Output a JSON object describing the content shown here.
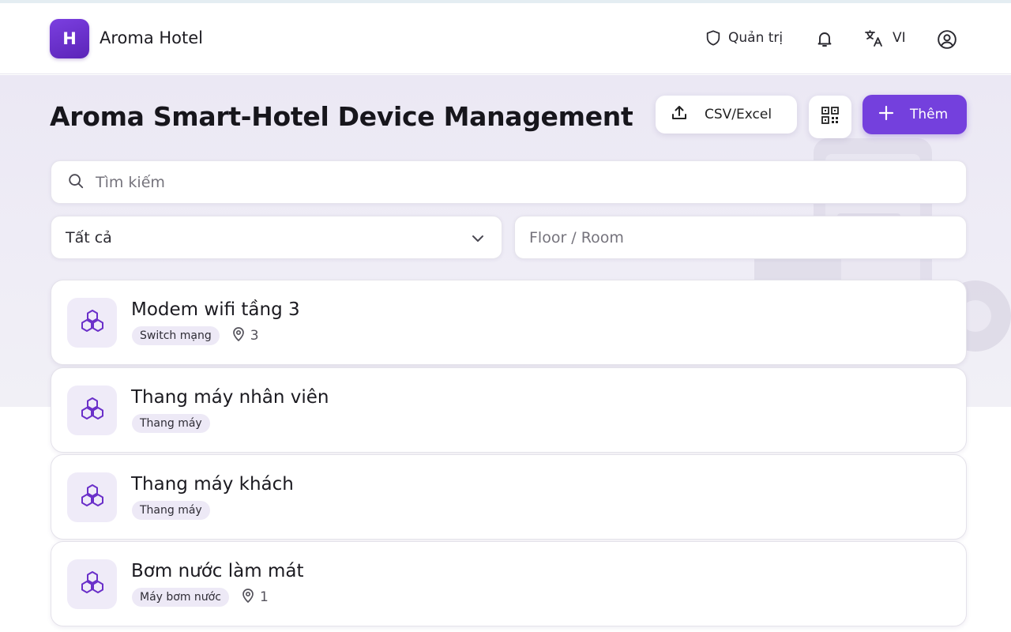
{
  "app": {
    "logo_letter": "H",
    "name": "Aroma Hotel"
  },
  "header": {
    "admin_label": "Quản trị",
    "language": "VI",
    "icons": [
      "shield-icon",
      "bell-icon",
      "translate-icon",
      "user-circle-icon"
    ]
  },
  "page": {
    "title": "Aroma Smart-Hotel Device Management"
  },
  "actions": {
    "csv_label": "CSV/Excel",
    "add_label": "Thêm"
  },
  "search": {
    "placeholder": "Tìm kiếm"
  },
  "filters": {
    "category_value": "Tất cả",
    "room_placeholder": "Floor / Room"
  },
  "devices": [
    {
      "name": "Modem wifi tầng 3",
      "type": "Switch mạng",
      "location": "3"
    },
    {
      "name": "Thang máy nhân viên",
      "type": "Thang máy",
      "location": ""
    },
    {
      "name": "Thang máy khách",
      "type": "Thang máy",
      "location": ""
    },
    {
      "name": "Bơm nước làm mát",
      "type": "Máy bơm nước",
      "location": "1"
    }
  ],
  "colors": {
    "accent": "#7440dd",
    "icon_tint": "#6a2fc9",
    "tag_bg": "#ede9f6"
  }
}
